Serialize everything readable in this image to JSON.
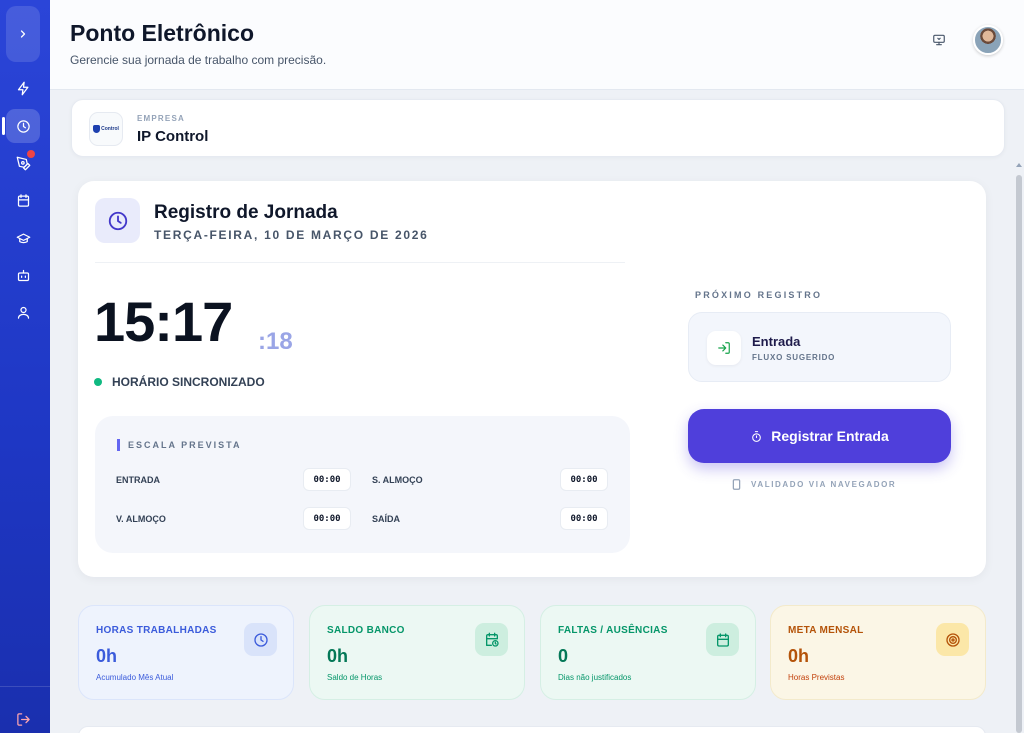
{
  "header": {
    "title": "Ponto Eletrônico",
    "subtitle": "Gerencie sua jornada de trabalho com precisão."
  },
  "sidebar": {
    "items": [
      {
        "icon": "chevron-right-icon"
      },
      {
        "icon": "zap-icon"
      },
      {
        "icon": "clock-icon",
        "active": true
      },
      {
        "icon": "pen-tool-icon",
        "badge": true
      },
      {
        "icon": "calendar-icon"
      },
      {
        "icon": "graduation-cap-icon"
      },
      {
        "icon": "bot-icon"
      },
      {
        "icon": "user-icon"
      },
      {
        "icon": "logout-icon"
      }
    ]
  },
  "company": {
    "label": "EMPRESA",
    "name": "IP Control",
    "logo_text": "Control"
  },
  "registro": {
    "title": "Registro de Jornada",
    "date": "TERÇA-FEIRA, 10 DE MARÇO DE 2026",
    "time_hm": "15:17",
    "time_s": ":18",
    "sync_status": "HORÁRIO SINCRONIZADO",
    "escala": {
      "title": "ESCALA PREVISTA",
      "entrada_label": "ENTRADA",
      "entrada_value": "00:00",
      "s_almoco_label": "S. ALMOÇO",
      "s_almoco_value": "00:00",
      "v_almoco_label": "V. ALMOÇO",
      "v_almoco_value": "00:00",
      "saida_label": "SAÍDA",
      "saida_value": "00:00"
    },
    "proximo": {
      "label": "PRÓXIMO REGISTRO",
      "title": "Entrada",
      "subtitle": "FLUXO SUGERIDO"
    },
    "button_label": "Registrar Entrada",
    "validated": "VALIDADO VIA NAVEGADOR"
  },
  "stats": [
    {
      "label": "HORAS TRABALHADAS",
      "value": "0h",
      "sub": "Acumulado Mês Atual",
      "icon": "clock-icon",
      "color": "#3b5bdb"
    },
    {
      "label": "SALDO BANCO",
      "value": "0h",
      "sub": "Saldo de Horas",
      "icon": "calendar-clock-icon",
      "color": "#059669"
    },
    {
      "label": "FALTAS / AUSÊNCIAS",
      "value": "0",
      "sub": "Dias não justificados",
      "icon": "calendar-icon",
      "color": "#059669"
    },
    {
      "label": "META MENSAL",
      "value": "0h",
      "sub": "Horas Previstas",
      "icon": "target-icon",
      "color": "#b45309"
    }
  ],
  "colors": {
    "sidebar": "#2b45d8",
    "primary_button": "#4f3fdb",
    "sync_dot": "#10b981"
  }
}
